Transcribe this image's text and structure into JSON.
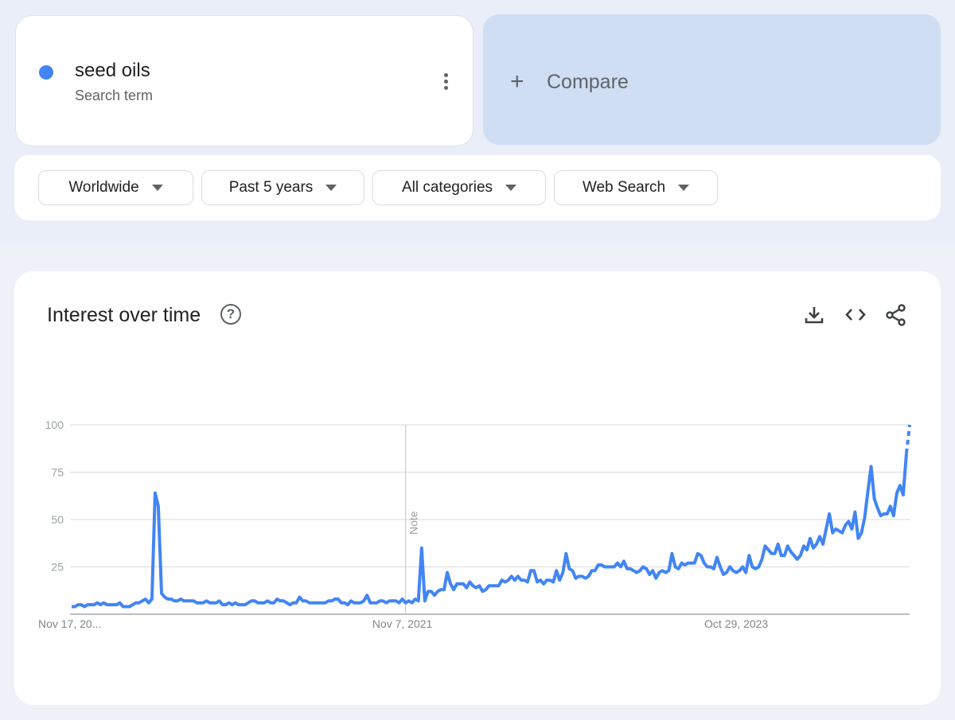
{
  "search_term": {
    "label": "seed oils",
    "sublabel": "Search term",
    "color": "#4285f4"
  },
  "compare": {
    "icon": "plus-icon",
    "label": "Compare"
  },
  "filters": [
    {
      "label": "Worldwide"
    },
    {
      "label": "Past 5 years"
    },
    {
      "label": "All categories"
    },
    {
      "label": "Web Search"
    }
  ],
  "chart_card": {
    "title": "Interest over time",
    "help_glyph": "?",
    "actions": [
      "download-icon",
      "embed-code-icon",
      "share-icon"
    ]
  },
  "chart_data": {
    "type": "line",
    "title": "Interest over time",
    "xlabel": "",
    "ylabel": "",
    "ylim": [
      0,
      100
    ],
    "yticks": [
      100,
      75,
      50,
      25
    ],
    "xtick_labels": [
      {
        "label": "Nov 17, 20...",
        "index": 0
      },
      {
        "label": "Nov 7, 2021",
        "index": 103
      },
      {
        "label": "Oct 29, 2023",
        "index": 207
      }
    ],
    "annotation": {
      "label": "Note",
      "index": 104
    },
    "partial_last_segment": true,
    "grid": true,
    "series": [
      {
        "name": "seed oils",
        "color": "#4285f4",
        "values": [
          4,
          4,
          5,
          5,
          4,
          5,
          5,
          5,
          6,
          5,
          6,
          5,
          5,
          5,
          5,
          6,
          4,
          4,
          4,
          5,
          6,
          6,
          7,
          8,
          6,
          8,
          64,
          57,
          11,
          9,
          8,
          8,
          7,
          7,
          8,
          7,
          7,
          7,
          7,
          6,
          6,
          6,
          7,
          6,
          6,
          6,
          7,
          5,
          5,
          6,
          5,
          6,
          5,
          5,
          5,
          6,
          7,
          7,
          6,
          6,
          6,
          7,
          6,
          6,
          8,
          7,
          7,
          6,
          5,
          6,
          6,
          9,
          7,
          7,
          6,
          6,
          6,
          6,
          6,
          6,
          7,
          7,
          8,
          8,
          6,
          6,
          5,
          7,
          6,
          6,
          6,
          7,
          10,
          6,
          6,
          6,
          7,
          7,
          6,
          7,
          7,
          7,
          6,
          8,
          6,
          7,
          6,
          8,
          7,
          35,
          7,
          12,
          12,
          10,
          12,
          13,
          13,
          22,
          16,
          13,
          16,
          16,
          16,
          14,
          17,
          15,
          14,
          15,
          12,
          13,
          15,
          15,
          15,
          15,
          18,
          17,
          18,
          20,
          18,
          20,
          18,
          18,
          17,
          23,
          23,
          17,
          18,
          16,
          18,
          18,
          17,
          23,
          18,
          22,
          32,
          24,
          23,
          19,
          20,
          20,
          19,
          20,
          23,
          23,
          26,
          26,
          25,
          25,
          25,
          25,
          27,
          25,
          28,
          24,
          24,
          23,
          22,
          23,
          25,
          24,
          21,
          23,
          19,
          22,
          23,
          22,
          23,
          32,
          25,
          24,
          27,
          26,
          27,
          27,
          27,
          32,
          31,
          27,
          25,
          25,
          24,
          30,
          25,
          21,
          22,
          25,
          23,
          22,
          23,
          25,
          22,
          31,
          25,
          24,
          25,
          29,
          36,
          34,
          32,
          32,
          37,
          31,
          31,
          36,
          33,
          31,
          29,
          31,
          36,
          34,
          40,
          35,
          37,
          41,
          37,
          45,
          53,
          43,
          45,
          44,
          43,
          47,
          49,
          45,
          54,
          40,
          43,
          51,
          65,
          78,
          61,
          56,
          52,
          53,
          53,
          57,
          52,
          64,
          68,
          63,
          85,
          100
        ]
      }
    ]
  }
}
